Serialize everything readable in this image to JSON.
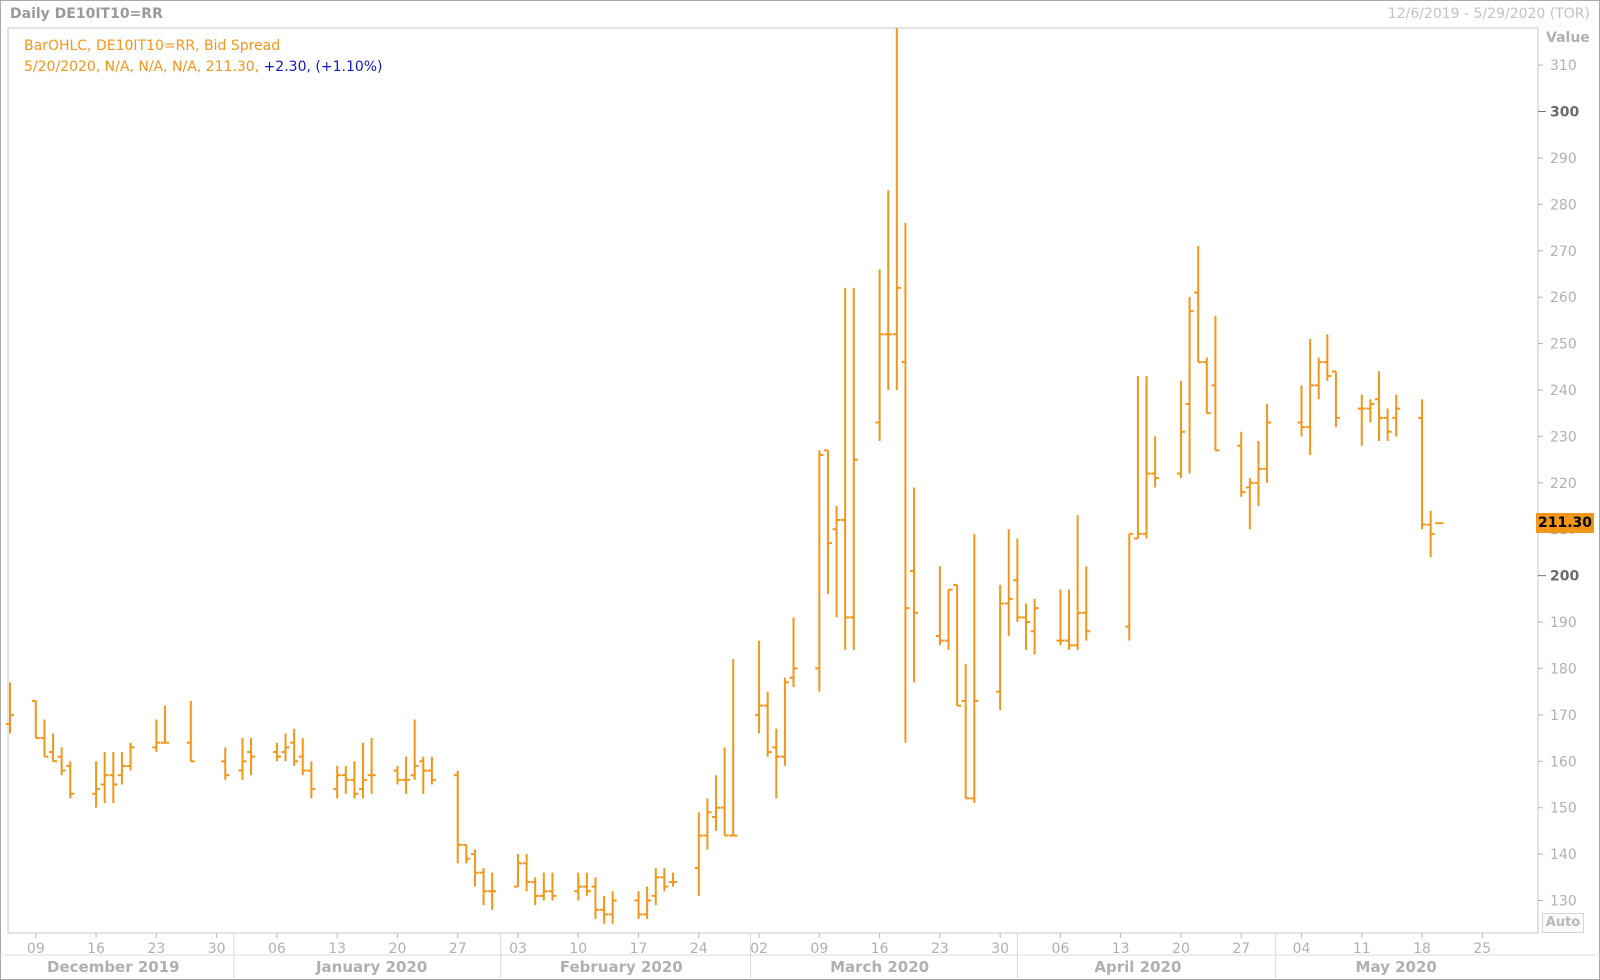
{
  "window": {
    "title": "Daily DE10IT10=RR",
    "date_range": "12/6/2019 - 5/29/2020 (TOR)"
  },
  "legend": {
    "line1": "BarOHLC, DE10IT10=RR, Bid Spread",
    "line2_values": "5/20/2020, N/A, N/A, N/A, 211.30,",
    "change": "+2.30,",
    "change_pct": "(+1.10%)"
  },
  "y_axis": {
    "title": "Value",
    "auto_button": "Auto",
    "last_price": "211.30"
  },
  "colors": {
    "bar": "#f2961a",
    "change_text": "#1515c8",
    "axis_text": "#b0b0b0",
    "background": "#ffffff"
  },
  "chart_data": {
    "type": "ohlc_bar",
    "title": "Daily DE10IT10=RR",
    "series_name": "BarOHLC, DE10IT10=RR, Bid Spread",
    "ylim": [
      123,
      318
    ],
    "yticks": [
      130,
      140,
      150,
      160,
      170,
      180,
      190,
      200,
      210,
      220,
      230,
      240,
      250,
      260,
      270,
      280,
      290,
      300,
      310
    ],
    "major_yticks": [
      200,
      300
    ],
    "xlim": [
      "2019-12-06",
      "2020-05-29"
    ],
    "x_day_ticks": [
      {
        "date": "2019-12-09",
        "label": "09"
      },
      {
        "date": "2019-12-16",
        "label": "16"
      },
      {
        "date": "2019-12-23",
        "label": "23"
      },
      {
        "date": "2019-12-30",
        "label": "30"
      },
      {
        "date": "2020-01-06",
        "label": "06"
      },
      {
        "date": "2020-01-13",
        "label": "13"
      },
      {
        "date": "2020-01-20",
        "label": "20"
      },
      {
        "date": "2020-01-27",
        "label": "27"
      },
      {
        "date": "2020-02-03",
        "label": "03"
      },
      {
        "date": "2020-02-10",
        "label": "10"
      },
      {
        "date": "2020-02-17",
        "label": "17"
      },
      {
        "date": "2020-02-24",
        "label": "24"
      },
      {
        "date": "2020-03-02",
        "label": "02"
      },
      {
        "date": "2020-03-09",
        "label": "09"
      },
      {
        "date": "2020-03-16",
        "label": "16"
      },
      {
        "date": "2020-03-23",
        "label": "23"
      },
      {
        "date": "2020-03-30",
        "label": "30"
      },
      {
        "date": "2020-04-06",
        "label": "06"
      },
      {
        "date": "2020-04-13",
        "label": "13"
      },
      {
        "date": "2020-04-20",
        "label": "20"
      },
      {
        "date": "2020-04-27",
        "label": "27"
      },
      {
        "date": "2020-05-04",
        "label": "04"
      },
      {
        "date": "2020-05-11",
        "label": "11"
      },
      {
        "date": "2020-05-18",
        "label": "18"
      },
      {
        "date": "2020-05-25",
        "label": "25"
      }
    ],
    "x_month_labels": [
      {
        "label": "December 2019",
        "center": "2019-12-18"
      },
      {
        "label": "January 2020",
        "center": "2020-01-17"
      },
      {
        "label": "February 2020",
        "center": "2020-02-15"
      },
      {
        "label": "March 2020",
        "center": "2020-03-16"
      },
      {
        "label": "April 2020",
        "center": "2020-04-15"
      },
      {
        "label": "May 2020",
        "center": "2020-05-15"
      }
    ],
    "month_separators": [
      "2020-01-01",
      "2020-02-01",
      "2020-03-01",
      "2020-04-01",
      "2020-05-01"
    ],
    "bars": [
      {
        "date": "2019-12-06",
        "o": 168,
        "h": 177,
        "l": 166,
        "c": 170
      },
      {
        "date": "2019-12-09",
        "o": 173,
        "h": 173,
        "l": 165,
        "c": 165
      },
      {
        "date": "2019-12-10",
        "o": 165,
        "h": 169,
        "l": 161,
        "c": 161
      },
      {
        "date": "2019-12-11",
        "o": 162,
        "h": 166,
        "l": 160,
        "c": 160
      },
      {
        "date": "2019-12-12",
        "o": 161,
        "h": 163,
        "l": 157,
        "c": 158
      },
      {
        "date": "2019-12-13",
        "o": 159,
        "h": 160,
        "l": 152,
        "c": 153
      },
      {
        "date": "2019-12-16",
        "o": 153,
        "h": 160,
        "l": 150,
        "c": 154
      },
      {
        "date": "2019-12-17",
        "o": 155,
        "h": 162,
        "l": 151,
        "c": 157
      },
      {
        "date": "2019-12-18",
        "o": 157,
        "h": 162,
        "l": 151,
        "c": 155
      },
      {
        "date": "2019-12-19",
        "o": 157,
        "h": 162,
        "l": 155,
        "c": 159
      },
      {
        "date": "2019-12-20",
        "o": 159,
        "h": 164,
        "l": 158,
        "c": 163
      },
      {
        "date": "2019-12-23",
        "o": 163,
        "h": 169,
        "l": 162,
        "c": 164
      },
      {
        "date": "2019-12-24",
        "o": 164,
        "h": 172,
        "l": 164,
        "c": 164
      },
      {
        "date": "2019-12-27",
        "o": 164,
        "h": 173,
        "l": 160,
        "c": 160
      },
      {
        "date": "2019-12-31",
        "o": 160,
        "h": 163,
        "l": 156,
        "c": 157
      },
      {
        "date": "2020-01-02",
        "o": 158,
        "h": 165,
        "l": 156,
        "c": 160
      },
      {
        "date": "2020-01-03",
        "o": 162,
        "h": 165,
        "l": 157,
        "c": 161
      },
      {
        "date": "2020-01-06",
        "o": 162,
        "h": 164,
        "l": 160,
        "c": 161
      },
      {
        "date": "2020-01-07",
        "o": 162,
        "h": 166,
        "l": 160,
        "c": 163
      },
      {
        "date": "2020-01-08",
        "o": 164,
        "h": 167,
        "l": 159,
        "c": 160
      },
      {
        "date": "2020-01-09",
        "o": 161,
        "h": 165,
        "l": 157,
        "c": 158
      },
      {
        "date": "2020-01-10",
        "o": 158,
        "h": 160,
        "l": 152,
        "c": 154
      },
      {
        "date": "2020-01-13",
        "o": 154,
        "h": 159,
        "l": 152,
        "c": 157
      },
      {
        "date": "2020-01-14",
        "o": 157,
        "h": 159,
        "l": 153,
        "c": 156
      },
      {
        "date": "2020-01-15",
        "o": 156,
        "h": 160,
        "l": 152,
        "c": 153
      },
      {
        "date": "2020-01-16",
        "o": 154,
        "h": 164,
        "l": 152,
        "c": 156
      },
      {
        "date": "2020-01-17",
        "o": 157,
        "h": 165,
        "l": 153,
        "c": 157
      },
      {
        "date": "2020-01-20",
        "o": 158,
        "h": 159,
        "l": 155,
        "c": 156
      },
      {
        "date": "2020-01-21",
        "o": 156,
        "h": 161,
        "l": 153,
        "c": 156
      },
      {
        "date": "2020-01-22",
        "o": 157,
        "h": 169,
        "l": 156,
        "c": 159
      },
      {
        "date": "2020-01-23",
        "o": 160,
        "h": 161,
        "l": 153,
        "c": 158
      },
      {
        "date": "2020-01-24",
        "o": 158,
        "h": 161,
        "l": 155,
        "c": 156
      },
      {
        "date": "2020-01-27",
        "o": 157,
        "h": 158,
        "l": 138,
        "c": 142
      },
      {
        "date": "2020-01-28",
        "o": 142,
        "h": 142,
        "l": 138,
        "c": 139
      },
      {
        "date": "2020-01-29",
        "o": 140,
        "h": 141,
        "l": 133,
        "c": 136
      },
      {
        "date": "2020-01-30",
        "o": 136,
        "h": 137,
        "l": 129,
        "c": 132
      },
      {
        "date": "2020-01-31",
        "o": 132,
        "h": 136,
        "l": 128,
        "c": 132
      },
      {
        "date": "2020-02-03",
        "o": 133,
        "h": 140,
        "l": 133,
        "c": 138
      },
      {
        "date": "2020-02-04",
        "o": 138,
        "h": 140,
        "l": 132,
        "c": 134
      },
      {
        "date": "2020-02-05",
        "o": 134,
        "h": 135,
        "l": 129,
        "c": 131
      },
      {
        "date": "2020-02-06",
        "o": 131,
        "h": 136,
        "l": 130,
        "c": 132
      },
      {
        "date": "2020-02-07",
        "o": 132,
        "h": 136,
        "l": 130,
        "c": 131
      },
      {
        "date": "2020-02-10",
        "o": 132,
        "h": 136,
        "l": 130,
        "c": 133
      },
      {
        "date": "2020-02-11",
        "o": 133,
        "h": 136,
        "l": 131,
        "c": 132
      },
      {
        "date": "2020-02-12",
        "o": 133,
        "h": 135,
        "l": 126,
        "c": 128
      },
      {
        "date": "2020-02-13",
        "o": 128,
        "h": 131,
        "l": 125,
        "c": 127
      },
      {
        "date": "2020-02-14",
        "o": 127,
        "h": 132,
        "l": 125,
        "c": 130
      },
      {
        "date": "2020-02-17",
        "o": 130,
        "h": 132,
        "l": 126,
        "c": 127
      },
      {
        "date": "2020-02-18",
        "o": 127,
        "h": 133,
        "l": 126,
        "c": 130
      },
      {
        "date": "2020-02-19",
        "o": 131,
        "h": 137,
        "l": 129,
        "c": 135
      },
      {
        "date": "2020-02-20",
        "o": 135,
        "h": 137,
        "l": 132,
        "c": 133
      },
      {
        "date": "2020-02-21",
        "o": 134,
        "h": 136,
        "l": 133,
        "c": 134
      },
      {
        "date": "2020-02-24",
        "o": 137,
        "h": 149,
        "l": 131,
        "c": 144
      },
      {
        "date": "2020-02-25",
        "o": 144,
        "h": 152,
        "l": 141,
        "c": 149
      },
      {
        "date": "2020-02-26",
        "o": 148,
        "h": 157,
        "l": 145,
        "c": 150
      },
      {
        "date": "2020-02-27",
        "o": 150,
        "h": 163,
        "l": 144,
        "c": 144
      },
      {
        "date": "2020-02-28",
        "o": 144,
        "h": 182,
        "l": 144,
        "c": 144
      },
      {
        "date": "2020-03-02",
        "o": 170,
        "h": 186,
        "l": 166,
        "c": 172
      },
      {
        "date": "2020-03-03",
        "o": 172,
        "h": 175,
        "l": 161,
        "c": 162
      },
      {
        "date": "2020-03-04",
        "o": 163,
        "h": 167,
        "l": 152,
        "c": 161
      },
      {
        "date": "2020-03-05",
        "o": 161,
        "h": 178,
        "l": 159,
        "c": 177
      },
      {
        "date": "2020-03-06",
        "o": 178,
        "h": 191,
        "l": 176,
        "c": 180
      },
      {
        "date": "2020-03-09",
        "o": 180,
        "h": 227,
        "l": 175,
        "c": 226
      },
      {
        "date": "2020-03-10",
        "o": 227,
        "h": 227,
        "l": 196,
        "c": 207
      },
      {
        "date": "2020-03-11",
        "o": 210,
        "h": 215,
        "l": 191,
        "c": 212
      },
      {
        "date": "2020-03-12",
        "o": 212,
        "h": 262,
        "l": 184,
        "c": 191
      },
      {
        "date": "2020-03-13",
        "o": 191,
        "h": 262,
        "l": 184,
        "c": 225
      },
      {
        "date": "2020-03-16",
        "o": 233,
        "h": 266,
        "l": 229,
        "c": 252
      },
      {
        "date": "2020-03-17",
        "o": 252,
        "h": 283,
        "l": 240,
        "c": 252
      },
      {
        "date": "2020-03-18",
        "o": 252,
        "h": 318,
        "l": 240,
        "c": 262
      },
      {
        "date": "2020-03-19",
        "o": 246,
        "h": 276,
        "l": 164,
        "c": 193
      },
      {
        "date": "2020-03-20",
        "o": 201,
        "h": 219,
        "l": 177,
        "c": 192
      },
      {
        "date": "2020-03-23",
        "o": 187,
        "h": 202,
        "l": 185,
        "c": 186
      },
      {
        "date": "2020-03-24",
        "o": 186,
        "h": 197,
        "l": 184,
        "c": 197
      },
      {
        "date": "2020-03-25",
        "o": 198,
        "h": 198,
        "l": 172,
        "c": 172
      },
      {
        "date": "2020-03-26",
        "o": 173,
        "h": 181,
        "l": 152,
        "c": 152
      },
      {
        "date": "2020-03-27",
        "o": 152,
        "h": 209,
        "l": 151,
        "c": 173
      },
      {
        "date": "2020-03-30",
        "o": 175,
        "h": 198,
        "l": 171,
        "c": 194
      },
      {
        "date": "2020-03-31",
        "o": 194,
        "h": 210,
        "l": 187,
        "c": 195
      },
      {
        "date": "2020-04-01",
        "o": 199,
        "h": 208,
        "l": 190,
        "c": 191
      },
      {
        "date": "2020-04-02",
        "o": 191,
        "h": 194,
        "l": 184,
        "c": 190
      },
      {
        "date": "2020-04-03",
        "o": 188,
        "h": 195,
        "l": 183,
        "c": 193
      },
      {
        "date": "2020-04-06",
        "o": 186,
        "h": 197,
        "l": 185,
        "c": 186
      },
      {
        "date": "2020-04-07",
        "o": 186,
        "h": 197,
        "l": 184,
        "c": 185
      },
      {
        "date": "2020-04-08",
        "o": 185,
        "h": 213,
        "l": 184,
        "c": 192
      },
      {
        "date": "2020-04-09",
        "o": 192,
        "h": 202,
        "l": 186,
        "c": 188
      },
      {
        "date": "2020-04-14",
        "o": 189,
        "h": 209,
        "l": 186,
        "c": 209
      },
      {
        "date": "2020-04-15",
        "o": 208,
        "h": 243,
        "l": 208,
        "c": 209
      },
      {
        "date": "2020-04-16",
        "o": 209,
        "h": 243,
        "l": 208,
        "c": 222
      },
      {
        "date": "2020-04-17",
        "o": 222,
        "h": 230,
        "l": 219,
        "c": 221
      },
      {
        "date": "2020-04-20",
        "o": 222,
        "h": 242,
        "l": 221,
        "c": 231
      },
      {
        "date": "2020-04-21",
        "o": 237,
        "h": 260,
        "l": 222,
        "c": 257
      },
      {
        "date": "2020-04-22",
        "o": 261,
        "h": 271,
        "l": 246,
        "c": 246
      },
      {
        "date": "2020-04-23",
        "o": 246,
        "h": 247,
        "l": 235,
        "c": 235
      },
      {
        "date": "2020-04-24",
        "o": 241,
        "h": 256,
        "l": 227,
        "c": 227
      },
      {
        "date": "2020-04-27",
        "o": 228,
        "h": 231,
        "l": 217,
        "c": 218
      },
      {
        "date": "2020-04-28",
        "o": 219,
        "h": 221,
        "l": 210,
        "c": 220
      },
      {
        "date": "2020-04-29",
        "o": 220,
        "h": 229,
        "l": 215,
        "c": 223
      },
      {
        "date": "2020-04-30",
        "o": 223,
        "h": 237,
        "l": 220,
        "c": 233
      },
      {
        "date": "2020-05-04",
        "o": 233,
        "h": 241,
        "l": 230,
        "c": 232
      },
      {
        "date": "2020-05-05",
        "o": 232,
        "h": 251,
        "l": 226,
        "c": 241
      },
      {
        "date": "2020-05-06",
        "o": 241,
        "h": 247,
        "l": 238,
        "c": 246
      },
      {
        "date": "2020-05-07",
        "o": 246,
        "h": 252,
        "l": 242,
        "c": 243
      },
      {
        "date": "2020-05-08",
        "o": 244,
        "h": 244,
        "l": 232,
        "c": 234
      },
      {
        "date": "2020-05-11",
        "o": 236,
        "h": 239,
        "l": 228,
        "c": 236
      },
      {
        "date": "2020-05-12",
        "o": 236,
        "h": 238,
        "l": 233,
        "c": 237
      },
      {
        "date": "2020-05-13",
        "o": 238,
        "h": 244,
        "l": 229,
        "c": 234
      },
      {
        "date": "2020-05-14",
        "o": 234,
        "h": 236,
        "l": 229,
        "c": 231
      },
      {
        "date": "2020-05-15",
        "o": 234,
        "h": 239,
        "l": 230,
        "c": 236
      },
      {
        "date": "2020-05-18",
        "o": 234,
        "h": 238,
        "l": 210,
        "c": 211
      },
      {
        "date": "2020-05-19",
        "o": 211,
        "h": 214,
        "l": 204,
        "c": 209
      },
      {
        "date": "2020-05-20",
        "o": null,
        "h": null,
        "l": null,
        "c": 211.3
      }
    ]
  }
}
